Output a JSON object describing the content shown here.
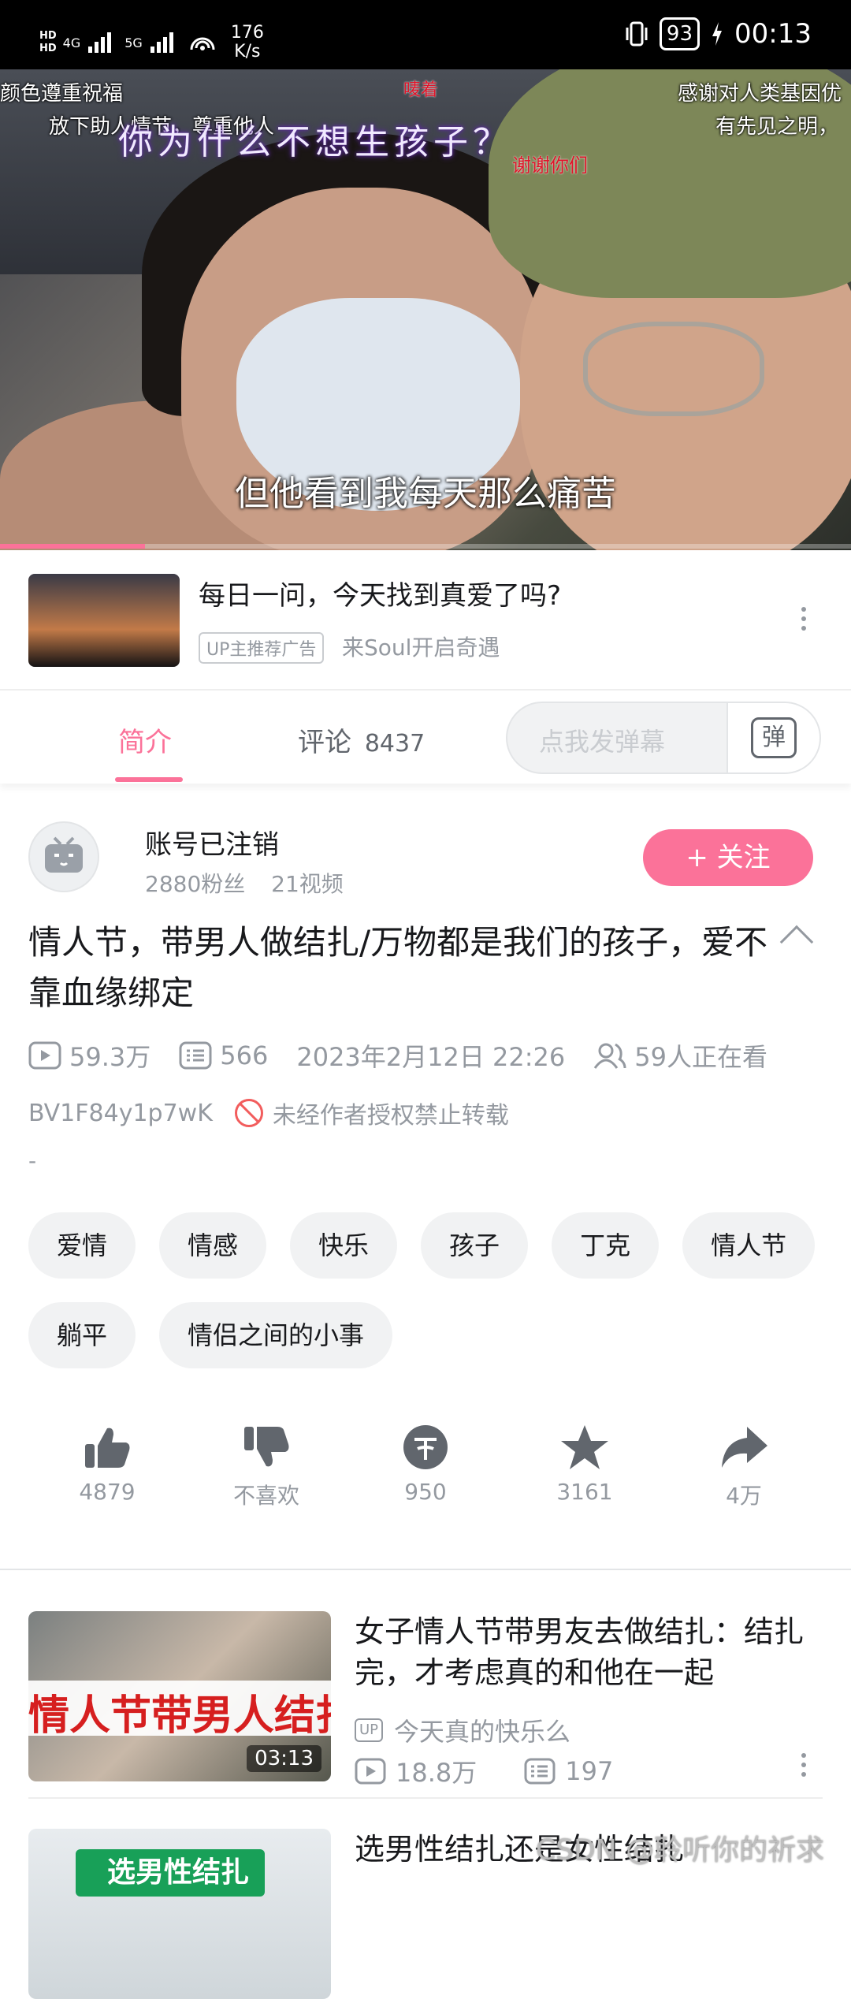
{
  "status_bar": {
    "network_left": "4G",
    "network_right": "5G",
    "speed_value": "176",
    "speed_unit": "K/s",
    "battery": "93",
    "time": "00:13"
  },
  "video": {
    "danmaku": [
      {
        "text": "颜色遵重祝福"
      },
      {
        "text": "放下助人情节，尊重他人"
      },
      {
        "text": "唛着"
      },
      {
        "text": "感谢对人类基因优"
      },
      {
        "text": "有先见之明，"
      },
      {
        "text": "谢谢你们"
      }
    ],
    "title_overlay": "你为什么不想生孩子？",
    "subtitle": "但他看到我每天那么痛苦",
    "progress_fraction": 0.17
  },
  "ad": {
    "title": "每日一问，今天找到真爱了吗?",
    "badge": "UP主推荐广告",
    "subtitle": "来Soul开启奇遇"
  },
  "tabs": {
    "intro": "简介",
    "comments_label": "评论",
    "comments_count": "8437",
    "danmaku_placeholder": "点我发弹幕",
    "danmaku_button": "弹"
  },
  "author": {
    "name": "账号已注销",
    "fans": "2880粉丝",
    "videos": "21视频",
    "follow": "+ 关注"
  },
  "video_info": {
    "title": "情人节，带男人做结扎/万物都是我们的孩子，爱不靠血缘绑定",
    "views": "59.3万",
    "danmaku_count": "566",
    "date": "2023年2月12日 22:26",
    "watching": "59人正在看",
    "bvid": "BV1F84y1p7wK",
    "copyright": "未经作者授权禁止转载",
    "description": "-"
  },
  "tags": [
    "爱情",
    "情感",
    "快乐",
    "孩子",
    "丁克",
    "情人节",
    "躺平",
    "情侣之间的小事"
  ],
  "actions": [
    {
      "icon": "thumbs-up-icon",
      "label": "4879"
    },
    {
      "icon": "thumbs-down-icon",
      "label": "不喜欢"
    },
    {
      "icon": "coin-icon",
      "label": "950"
    },
    {
      "icon": "star-icon",
      "label": "3161"
    },
    {
      "icon": "share-icon",
      "label": "4万"
    }
  ],
  "recommendations": [
    {
      "title": "女子情人节带男友去做结扎：结扎完，才考虑真的和他在一起",
      "thumb_text": "情人节带男人结扎",
      "duration": "03:13",
      "up_badge": "UP",
      "up": "今天真的快乐么",
      "views": "18.8万",
      "danmaku": "197"
    },
    {
      "title": "选男性结扎还是女性结扎",
      "thumb_text": "选男性结扎"
    }
  ],
  "watermark": "CSDN @聆听你的祈求",
  "colors": {
    "accent": "#fb7299",
    "muted": "#9499a0",
    "tag_bg": "#f1f2f3"
  }
}
